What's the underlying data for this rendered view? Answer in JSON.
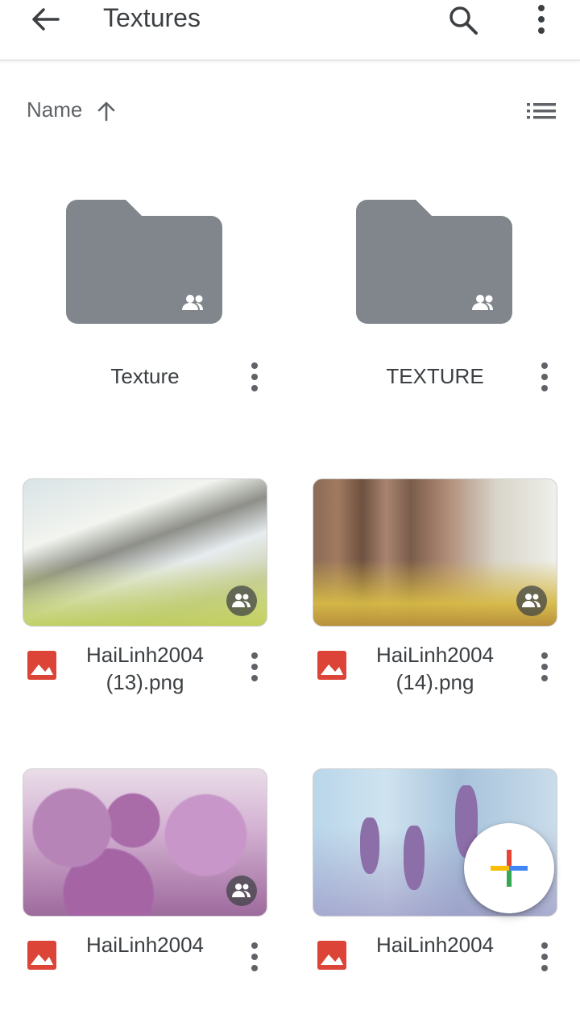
{
  "appbar": {
    "title": "Textures"
  },
  "sort": {
    "label": "Name"
  },
  "folders": [
    {
      "name": "Texture"
    },
    {
      "name": "TEXTURE"
    }
  ],
  "files": [
    {
      "name_line1": "HaiLinh2004",
      "name_line2": "(13).png"
    },
    {
      "name_line1": "HaiLinh2004",
      "name_line2": "(14).png"
    },
    {
      "name_line1": "HaiLinh2004",
      "name_line2": ""
    },
    {
      "name_line1": "HaiLinh2004",
      "name_line2": ""
    }
  ],
  "icons": {
    "back": "arrow-back-icon",
    "search": "search-icon",
    "more": "more-vert-icon",
    "sort": "arrow-up-icon",
    "list": "list-view-icon",
    "folder": "shared-folder-icon",
    "image": "image-file-icon",
    "add": "plus-icon"
  },
  "colors": {
    "folder": "#80868b",
    "image_icon": "#db4437",
    "fab_blue": "#4285f4",
    "fab_red": "#ea4335",
    "fab_yellow": "#fbbc04",
    "fab_green": "#34a853"
  }
}
